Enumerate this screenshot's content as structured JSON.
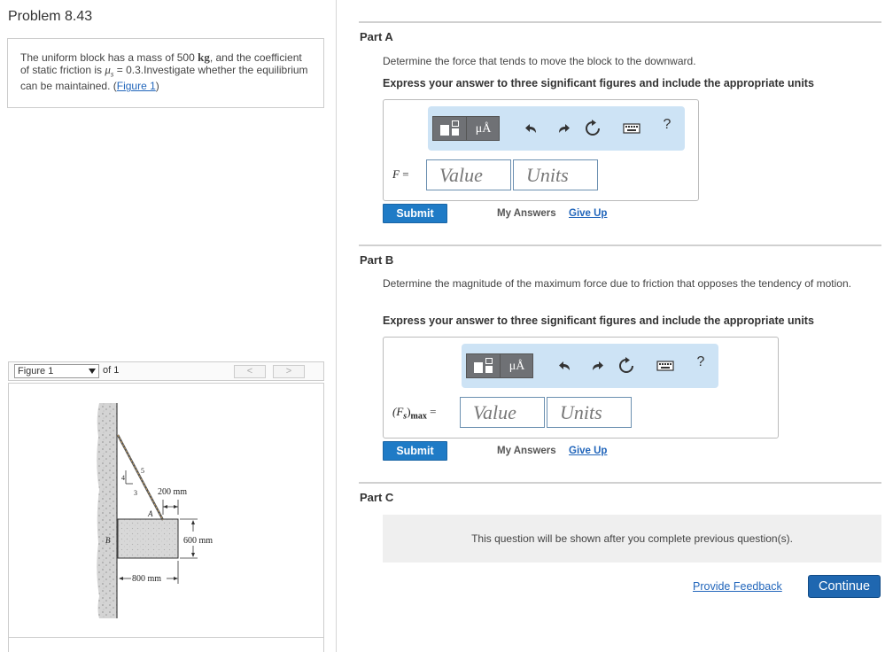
{
  "problem": {
    "title": "Problem 8.43",
    "text_1": "The uniform block has a mass of 500 ",
    "mass_unit": "kg",
    "text_2": ", and the coefficient of static friction is ",
    "mu_symbol": "μ",
    "mu_sub": "s",
    "text_3": " = 0.3.Investigate whether the equilibrium can be maintained. (",
    "figure_link": "Figure 1",
    "text_4": ")"
  },
  "figure_nav": {
    "select_value": "Figure 1",
    "of_label": "of 1",
    "prev": "<",
    "next": ">"
  },
  "figure": {
    "dim_top": "200 mm",
    "dim_side": "600 mm",
    "dim_bottom": "800 mm",
    "label_a": "A",
    "label_b": "B",
    "slope_4": "4",
    "slope_3": "3",
    "slope_5": "5"
  },
  "toolbar": {
    "mu_label": "μÅ",
    "help": "?"
  },
  "part_a": {
    "label": "Part A",
    "question": "Determine the force that tends to move the block to the downward.",
    "instruction": "Express your answer to three significant figures and include the appropriate units",
    "var": "F",
    "eq": " =",
    "value_placeholder": "Value",
    "units_placeholder": "Units",
    "submit": "Submit",
    "my_answers": "My Answers",
    "give_up": "Give Up"
  },
  "part_b": {
    "label": "Part B",
    "question": "Determine the magnitude of the maximum force due to friction that opposes the tendency of motion.",
    "instruction": "Express your answer to three significant figures and include the appropriate units",
    "var_open": "(F",
    "var_sub": "s",
    "var_close": ")",
    "var_max": "max",
    "eq": " =",
    "value_placeholder": "Value",
    "units_placeholder": "Units",
    "submit": "Submit",
    "my_answers": "My Answers",
    "give_up": "Give Up"
  },
  "part_c": {
    "label": "Part C",
    "notice": "This question will be shown after you complete previous question(s)."
  },
  "footer": {
    "feedback": "Provide Feedback",
    "continue": "Continue"
  },
  "colors": {
    "accent": "#1f7bc6",
    "link": "#2266bb",
    "toolbar_bg": "#cde3f5"
  }
}
